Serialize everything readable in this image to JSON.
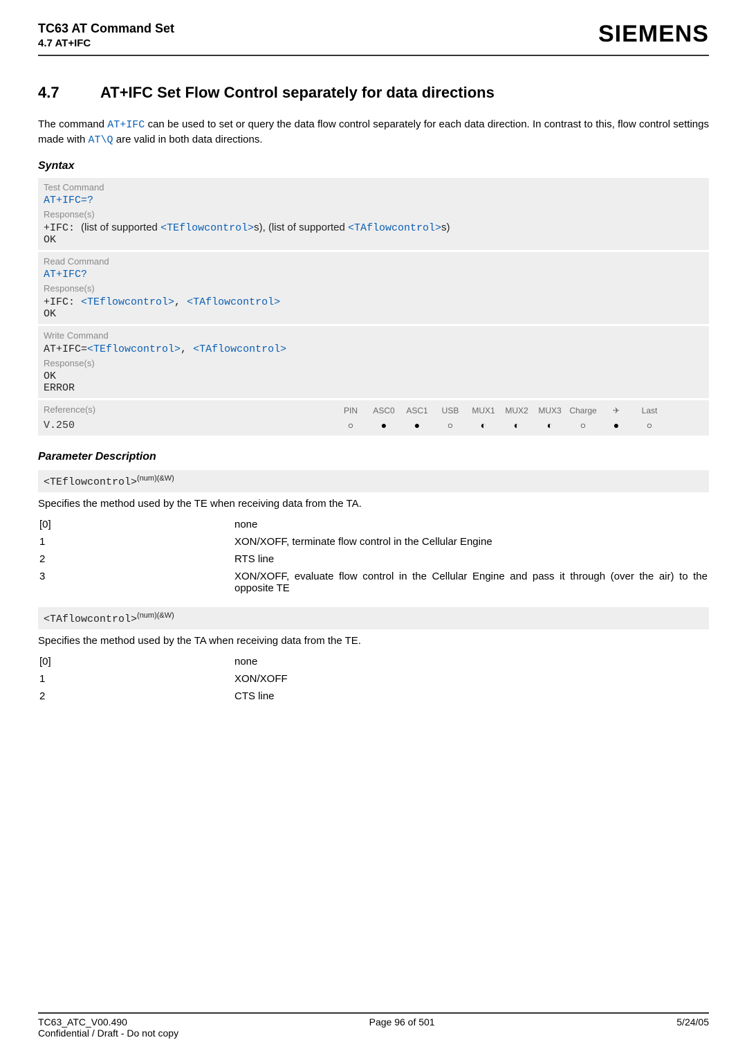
{
  "header": {
    "product": "TC63 AT Command Set",
    "section_short": "4.7 AT+IFC",
    "logo": "SIEMENS"
  },
  "section": {
    "num": "4.7",
    "title": "AT+IFC   Set Flow Control separately for data directions"
  },
  "intro": {
    "p1a": "The command ",
    "cmd1": "AT+IFC",
    "p1b": " can be used to set or query the data flow control separately for each data direction. In contrast to this, flow control settings made with ",
    "cmd2": "AT\\Q",
    "p1c": " are valid in both data directions."
  },
  "syntax_label": "Syntax",
  "test_block": {
    "label": "Test Command",
    "cmd": "AT+IFC=?",
    "resp_label": "Response(s)",
    "resp_prefix": "+IFC: ",
    "resp_text1": "(list of supported ",
    "tag1": "<TEflowcontrol>",
    "resp_text2": "s), (list of supported ",
    "tag2": "<TAflowcontrol>",
    "resp_text3": "s)",
    "ok": "OK"
  },
  "read_block": {
    "label": "Read Command",
    "cmd": "AT+IFC?",
    "resp_label": "Response(s)",
    "resp_prefix": "+IFC: ",
    "tag1": "<TEflowcontrol>",
    "comma": ", ",
    "tag2": "<TAflowcontrol>",
    "ok": "OK"
  },
  "write_block": {
    "label": "Write Command",
    "cmd_prefix": "AT+IFC=",
    "tag1": "<TEflowcontrol>",
    "comma": ", ",
    "tag2": "<TAflowcontrol>",
    "resp_label": "Response(s)",
    "ok": "OK",
    "error": "ERROR"
  },
  "ref_block": {
    "left_label": "Reference(s)",
    "cols": [
      "PIN",
      "ASC0",
      "ASC1",
      "USB",
      "MUX1",
      "MUX2",
      "MUX3",
      "Charge",
      "✈",
      "Last"
    ],
    "value": "V.250",
    "icons": [
      "○",
      "●",
      "●",
      "○",
      "◐",
      "◐",
      "◐",
      "○",
      "●",
      "○"
    ]
  },
  "param_label": "Parameter Description",
  "te": {
    "tag": "<TEflowcontrol>",
    "sup": "(num)(&W)",
    "desc": "Specifies the method used by the TE when receiving data from the TA.",
    "rows": [
      {
        "k": "[0]",
        "v": "none"
      },
      {
        "k": "1",
        "v": "XON/XOFF, terminate flow control in the Cellular Engine"
      },
      {
        "k": "2",
        "v": "RTS line"
      },
      {
        "k": "3",
        "v": "XON/XOFF, evaluate flow control in the Cellular Engine and pass it through (over the air) to the opposite TE"
      }
    ]
  },
  "ta": {
    "tag": "<TAflowcontrol>",
    "sup": "(num)(&W)",
    "desc": "Specifies the method used by the TA when receiving data from the TE.",
    "rows": [
      {
        "k": "[0]",
        "v": "none"
      },
      {
        "k": "1",
        "v": "XON/XOFF"
      },
      {
        "k": "2",
        "v": "CTS line"
      }
    ]
  },
  "footer": {
    "left": "TC63_ATC_V00.490",
    "center": "Page 96 of 501",
    "right": "5/24/05",
    "sub": "Confidential / Draft - Do not copy"
  }
}
